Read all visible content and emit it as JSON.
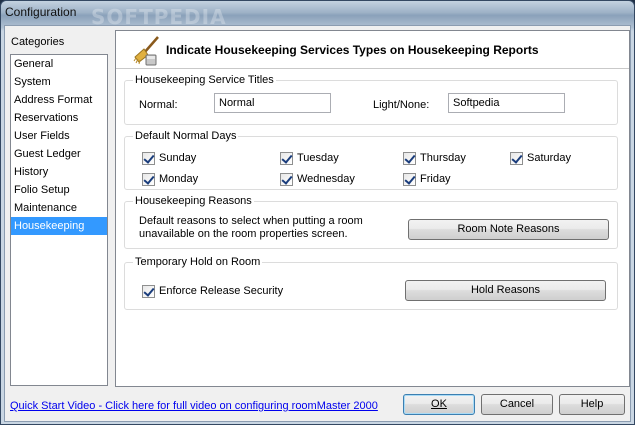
{
  "window": {
    "title": "Configuration",
    "watermark": "SOFTPEDIA"
  },
  "sidebar": {
    "label": "Categories",
    "items": [
      {
        "label": "General",
        "selected": false
      },
      {
        "label": "System",
        "selected": false
      },
      {
        "label": "Address Format",
        "selected": false
      },
      {
        "label": "Reservations",
        "selected": false
      },
      {
        "label": "User Fields",
        "selected": false
      },
      {
        "label": "Guest Ledger",
        "selected": false
      },
      {
        "label": "History",
        "selected": false
      },
      {
        "label": "Folio Setup",
        "selected": false
      },
      {
        "label": "Maintenance",
        "selected": false
      },
      {
        "label": "Housekeeping",
        "selected": true
      }
    ]
  },
  "panel": {
    "header_title": "Indicate Housekeeping Services Types on Housekeeping Reports",
    "header_icon": "broom-icon",
    "service_titles": {
      "group_label": "Housekeeping Service Titles",
      "normal_label": "Normal:",
      "normal_value": "Normal",
      "light_label": "Light/None:",
      "light_value": "Softpedia"
    },
    "normal_days": {
      "group_label": "Default Normal Days",
      "days": [
        {
          "label": "Sunday",
          "checked": true
        },
        {
          "label": "Tuesday",
          "checked": true
        },
        {
          "label": "Thursday",
          "checked": true
        },
        {
          "label": "Saturday",
          "checked": true
        },
        {
          "label": "Monday",
          "checked": true
        },
        {
          "label": "Wednesday",
          "checked": true
        },
        {
          "label": "Friday",
          "checked": true
        }
      ]
    },
    "reasons": {
      "group_label": "Housekeeping Reasons",
      "description": "Default reasons to select when putting a room unavailable on the room properties screen.",
      "button_label": "Room Note Reasons"
    },
    "temp_hold": {
      "group_label": "Temporary Hold on Room",
      "checkbox_label": "Enforce Release Security",
      "checked": true,
      "button_label": "Hold Reasons"
    }
  },
  "footer": {
    "link_text": "Quick Start Video - Click here for full video on configuring roomMaster 2000",
    "ok_label": "OK",
    "cancel_label": "Cancel",
    "help_label": "Help"
  },
  "colors": {
    "selection": "#3399ff",
    "link": "#0000ee"
  }
}
